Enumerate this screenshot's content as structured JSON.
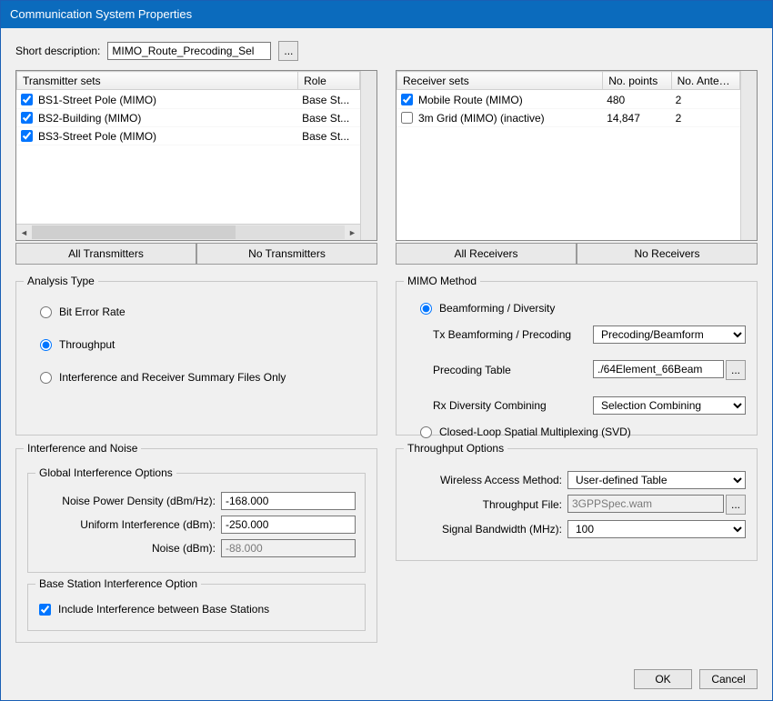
{
  "window": {
    "title": "Communication System Properties"
  },
  "shortDescription": {
    "label": "Short description:",
    "value": "MIMO_Route_Precoding_Sel",
    "browse": "..."
  },
  "transmitters": {
    "headers": [
      "Transmitter sets",
      "Role"
    ],
    "rows": [
      {
        "checked": true,
        "name": "BS1-Street Pole (MIMO)",
        "role": "Base St..."
      },
      {
        "checked": true,
        "name": "BS2-Building (MIMO)",
        "role": "Base St..."
      },
      {
        "checked": true,
        "name": "BS3-Street Pole (MIMO)",
        "role": "Base St..."
      }
    ],
    "allBtn": "All Transmitters",
    "noneBtn": "No Transmitters"
  },
  "receivers": {
    "headers": [
      "Receiver sets",
      "No. points",
      "No. Anten..."
    ],
    "rows": [
      {
        "checked": true,
        "name": "Mobile Route (MIMO)",
        "points": "480",
        "ant": "2"
      },
      {
        "checked": false,
        "name": "3m Grid (MIMO) (inactive)",
        "points": "14,847",
        "ant": "2"
      }
    ],
    "allBtn": "All Receivers",
    "noneBtn": "No Receivers"
  },
  "analysisType": {
    "legend": "Analysis Type",
    "options": {
      "ber": "Bit Error Rate",
      "thr": "Throughput",
      "ifx": "Interference and Receiver Summary Files Only"
    },
    "selected": "thr"
  },
  "mimo": {
    "legend": "MIMO Method",
    "options": {
      "beam": "Beamforming / Diversity",
      "svd": "Closed-Loop Spatial Multiplexing (SVD)"
    },
    "selected": "beam",
    "txLabel": "Tx Beamforming / Precoding",
    "txValue": "Precoding/Beamform",
    "pretableLabel": "Precoding Table",
    "pretableValue": "./64Element_66Beam",
    "rxLabel": "Rx Diversity Combining",
    "rxValue": "Selection Combining",
    "browse": "..."
  },
  "interference": {
    "legend": "Interference and Noise",
    "globalLegend": "Global Interference Options",
    "noisePD": {
      "label": "Noise Power Density (dBm/Hz):",
      "value": "-168.000"
    },
    "uniform": {
      "label": "Uniform Interference (dBm):",
      "value": "-250.000"
    },
    "noise": {
      "label": "Noise (dBm):",
      "value": "-88.000"
    },
    "bsLegend": "Base Station Interference Option",
    "bsInclude": {
      "label": "Include Interference between Base Stations",
      "checked": true
    }
  },
  "throughput": {
    "legend": "Throughput Options",
    "wam": {
      "label": "Wireless Access Method:",
      "value": "User-defined Table"
    },
    "file": {
      "label": "Throughput File:",
      "value": "3GPPSpec.wam",
      "browse": "..."
    },
    "bw": {
      "label": "Signal Bandwidth (MHz):",
      "value": "100"
    }
  },
  "buttons": {
    "ok": "OK",
    "cancel": "Cancel"
  }
}
